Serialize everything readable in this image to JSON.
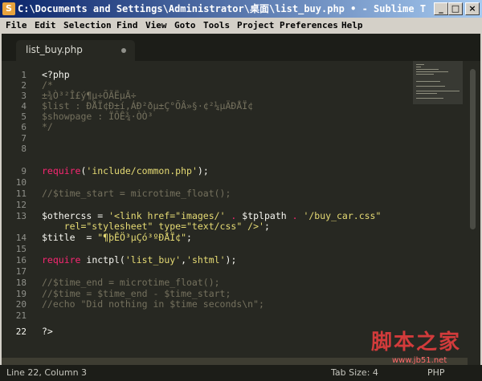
{
  "window": {
    "title": "C:\\Documents and Settings\\Administrator\\桌面\\list_buy.php • - Sublime Te...",
    "app_icon": "S",
    "minimize_glyph": "_",
    "maximize_glyph": "□",
    "close_glyph": "×"
  },
  "menu": [
    "File",
    "Edit",
    "Selection",
    "Find",
    "View",
    "Goto",
    "Tools",
    "Project",
    "Preferences",
    "Help"
  ],
  "tab": {
    "label": "list_buy.php",
    "modified_dot": true
  },
  "gutter": [
    "1",
    "2",
    "3",
    "4",
    "5",
    "6",
    "7",
    "8",
    "9",
    "10",
    "11",
    "12",
    "13",
    "",
    "14",
    "15",
    "16",
    "17",
    "18",
    "19",
    "20",
    "21",
    "22"
  ],
  "code": [
    [
      {
        "t": "<?php",
        "c": "pl"
      }
    ],
    [
      {
        "t": "/*",
        "c": "cm"
      }
    ],
    [
      {
        "t": "±¾Ò³²Î£ý¶µ÷ÕÃËµÃ÷",
        "c": "cm"
      }
    ],
    [
      {
        "t": "$list : ÐÅÏ¢Ð±í,ÁÐ²ðµ±Ç°ÕÂ»§·¢²¼µÄÐÅÏ¢",
        "c": "cm"
      }
    ],
    [
      {
        "t": "$showpage : ÏÔÊ¾·ÒÒ³",
        "c": "cm"
      }
    ],
    [
      {
        "t": "*/",
        "c": "cm"
      }
    ],
    [],
    [],
    [
      {
        "t": "require",
        "c": "kw"
      },
      {
        "t": "(",
        "c": "pl"
      },
      {
        "t": "'include/common.php'",
        "c": "st"
      },
      {
        "t": ");",
        "c": "pl"
      }
    ],
    [],
    [
      {
        "t": "//$time_start = microtime_float();",
        "c": "cm"
      }
    ],
    [],
    [
      {
        "t": "$othercss = ",
        "c": "pl"
      },
      {
        "t": "'<link href=\"images/'",
        "c": "st"
      },
      {
        "t": " . ",
        "c": "kw"
      },
      {
        "t": "$tplpath",
        "c": "pl"
      },
      {
        "t": " . ",
        "c": "kw"
      },
      {
        "t": "'/buy_car.css\"",
        "c": "st"
      }
    ],
    [
      {
        "t": "    rel=\"stylesheet\" type=\"text/css\" />'",
        "c": "st"
      },
      {
        "t": ";",
        "c": "pl"
      }
    ],
    [
      {
        "t": "$title  = ",
        "c": "pl"
      },
      {
        "t": "\"¶þÊÖ³µÇó³ºÐÅÏ¢\"",
        "c": "st"
      },
      {
        "t": ";",
        "c": "pl"
      }
    ],
    [],
    [
      {
        "t": "require",
        "c": "kw"
      },
      {
        "t": " inctpl(",
        "c": "pl"
      },
      {
        "t": "'list_buy'",
        "c": "st"
      },
      {
        "t": ",",
        "c": "pl"
      },
      {
        "t": "'shtml'",
        "c": "st"
      },
      {
        "t": ");",
        "c": "pl"
      }
    ],
    [],
    [
      {
        "t": "//$time_end = microtime_float();",
        "c": "cm"
      }
    ],
    [
      {
        "t": "//$time = $time_end - $time_start;",
        "c": "cm"
      }
    ],
    [
      {
        "t": "//echo \"Did nothing in $time seconds\\n\";",
        "c": "cm"
      }
    ],
    [],
    [
      {
        "t": "?>",
        "c": "pl"
      }
    ]
  ],
  "status": {
    "position": "Line 22, Column 3",
    "tab_size": "Tab Size: 4",
    "syntax": "PHP"
  },
  "watermark": {
    "text": "脚本之家",
    "url": "www.jb51.net"
  },
  "colors": {
    "background": "#272822",
    "comment": "#75715e",
    "keyword": "#f92672",
    "string": "#e6db74",
    "text": "#f8f8f2"
  }
}
